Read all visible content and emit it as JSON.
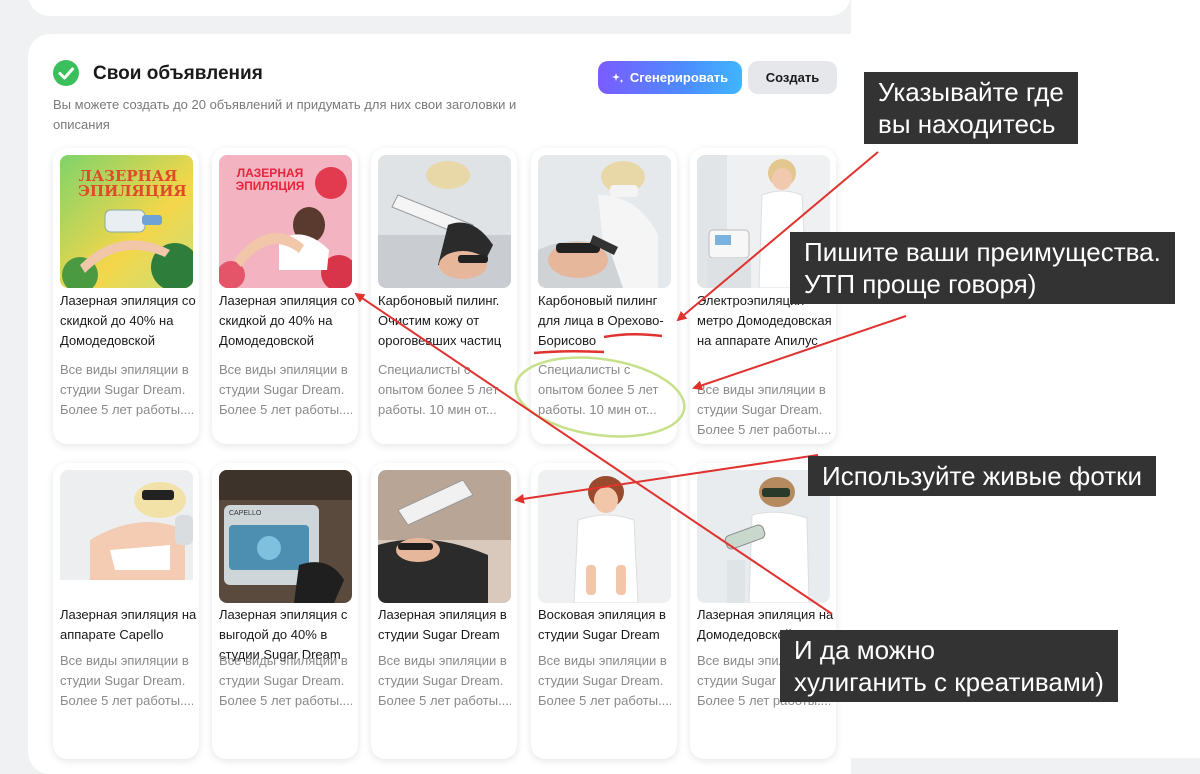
{
  "section": {
    "title": "Свои объявления",
    "subtitle": "Вы можете создать до 20 объявлений и придумать для них свои заголовки и описания"
  },
  "buttons": {
    "generate": "Сгенерировать",
    "create": "Создать"
  },
  "cards": [
    {
      "title": "Лазерная эпиляция со скидкой до 40% на Домодедовской",
      "desc": [
        "Все виды эпиляции в",
        "студии Sugar Dream.",
        "Более 5 лет работы...."
      ],
      "image_text": "ЛАЗЕРНАЯ ЭПИЛЯЦИЯ"
    },
    {
      "title": "Лазерная эпиляция со скидкой до 40% на Домодедовской",
      "desc": [
        "Все виды эпиляции в",
        "студии Sugar Dream.",
        "Более 5 лет работы...."
      ],
      "image_text": "ЛАЗЕРНАЯ ЭПИЛЯЦИЯ"
    },
    {
      "title": "Карбоновый пилинг. Очистим кожу от ороговевших частиц",
      "desc": [
        "Специалисты с",
        "опытом более 5 лет",
        "работы. 10 мин от..."
      ],
      "image_text": ""
    },
    {
      "title_pre": "Карбоновый пилинг для лица в ",
      "title_hl": "Орехово-Борисово",
      "desc": [
        "Специалисты с",
        "опытом более 5 лет",
        "работы. 10 мин от..."
      ],
      "image_text": ""
    },
    {
      "title": "Электроэпиляция метро Домодедовская на аппарате Апилус",
      "desc": [
        "Все виды эпиляции в",
        "студии Sugar Dream.",
        "Более 5 лет работы...."
      ],
      "image_text": ""
    },
    {
      "title": "Лазерная эпиляция на аппарате Capello",
      "desc": [
        "Все виды эпиляции в",
        "студии Sugar Dream.",
        "Более 5 лет работы...."
      ],
      "image_text": ""
    },
    {
      "title": "Лазерная эпиляция с выгодой до 40% в студии Sugar Dream",
      "desc": [
        "Все виды эпиляции в",
        "студии Sugar Dream.",
        "Более 5 лет работы...."
      ],
      "image_text": "CAPELLO"
    },
    {
      "title": "Лазерная эпиляция в студии Sugar Dream",
      "desc": [
        "Все виды эпиляции в",
        "студии Sugar Dream.",
        "Более 5 лет работы...."
      ],
      "image_text": ""
    },
    {
      "title": "Восковая эпиляция в студии Sugar Dream",
      "desc": [
        "Все виды эпиляции в",
        "студии Sugar Dream.",
        "Более 5 лет работы...."
      ],
      "image_text": ""
    },
    {
      "title": "Лазерная эпиляция на Домодедовской",
      "desc": [
        "Все виды эпиляции в",
        "студии Sugar Dream.",
        "Более 5 лет работы...."
      ],
      "image_text": ""
    }
  ],
  "annotations": {
    "location": [
      "Указывайте где",
      "вы находитесь"
    ],
    "usp": [
      "Пишите ваши преимущества.",
      "УТП проще говоря)"
    ],
    "photos": [
      "Используйте живые фотки"
    ],
    "creative": [
      "И да можно",
      "хулиганить с креативами)"
    ]
  },
  "colors": {
    "accent_green": "#3bbf5c",
    "arrow_red": "#e0322e",
    "highlight_green": "#c7e08a",
    "annotation_bg": "#333333"
  }
}
